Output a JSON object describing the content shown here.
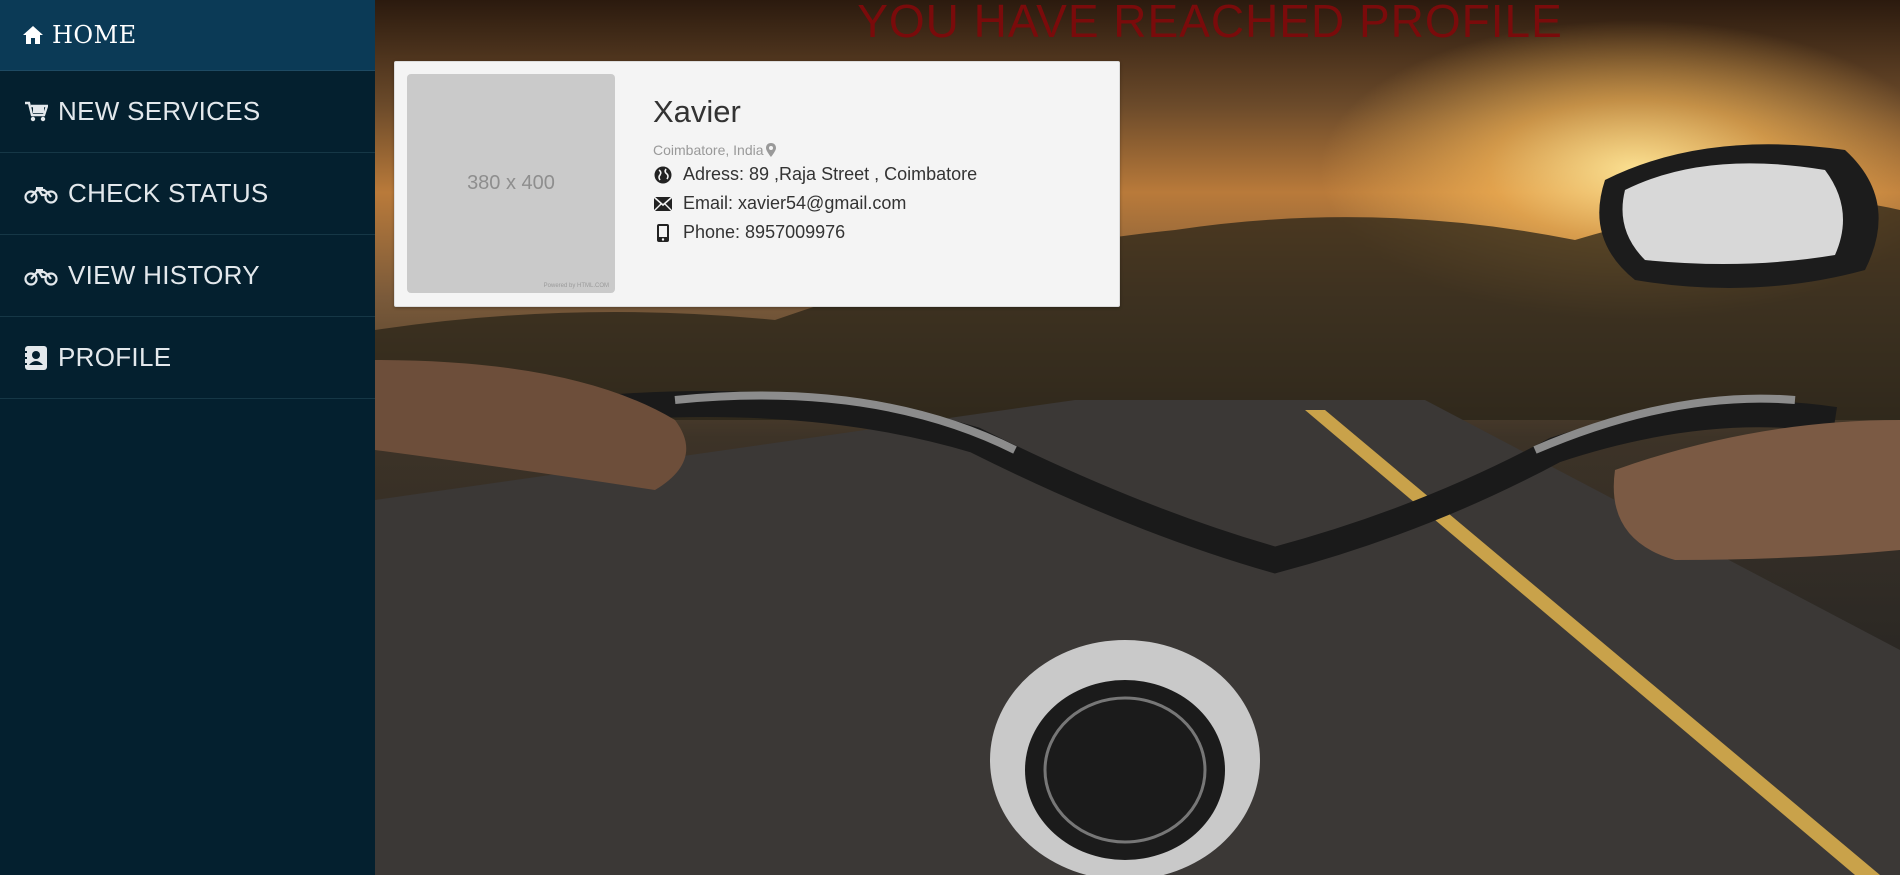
{
  "sidebar": {
    "home": {
      "label": "HOME",
      "icon": "home-icon"
    },
    "items": [
      {
        "label": "NEW SERVICES",
        "icon": "cart-icon"
      },
      {
        "label": "CHECK STATUS",
        "icon": "motorcycle-icon"
      },
      {
        "label": "VIEW HISTORY",
        "icon": "motorcycle-icon"
      },
      {
        "label": "PROFILE",
        "icon": "contact-card-icon"
      }
    ]
  },
  "main": {
    "title": "YOU HAVE REACHED PROFILE",
    "background": "motorcycle-road-sunset-photo"
  },
  "profile": {
    "avatar_placeholder": "380 x 400",
    "avatar_credit": "Powered by HTML.COM",
    "name": "Xavier",
    "location": "Coimbatore, India",
    "address": "Adress: 89 ,Raja Street , Coimbatore",
    "email": "Email: xavier54@gmail.com",
    "phone": "Phone: 8957009976"
  },
  "colors": {
    "sidebar_bg": "#04202f",
    "home_bg": "#0b3a56",
    "title_color": "#7a0b0b",
    "card_bg": "#f4f4f4"
  }
}
